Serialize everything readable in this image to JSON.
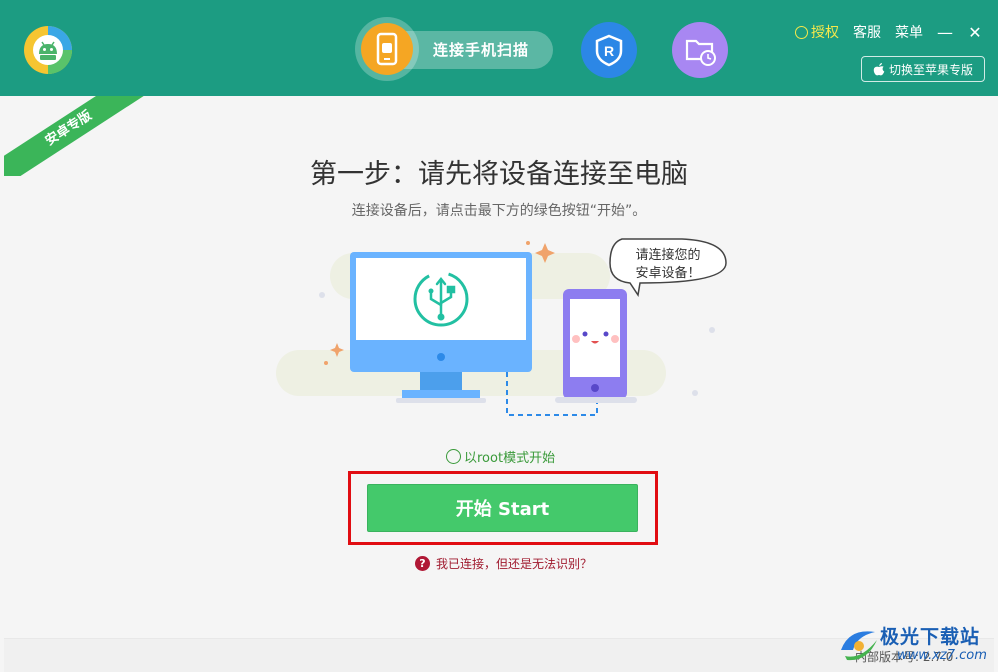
{
  "header": {
    "nav_label": "连接手机扫描",
    "auth_label": "授权",
    "service_label": "客服",
    "menu_label": "菜单",
    "switch_label": "切换至苹果专版",
    "minimize_label": "—",
    "close_label": "✕",
    "brand_color": "#1c9c82"
  },
  "ribbon": {
    "label": "安卓专版"
  },
  "main": {
    "title": "第一步：请先将设备连接至电脑",
    "subtitle": "连接设备后，请点击最下方的绿色按钮“开始”。",
    "bubble_line1": "请连接您的",
    "bubble_line2": "安卓设备！",
    "root_option_label": "以root模式开始",
    "start_button_label": "开始  Start",
    "help_label": "我已连接，但还是无法识别？",
    "help_icon_glyph": "?"
  },
  "footer": {
    "version_text": "内部版本号: 2.7.0",
    "watermark_text": "极光下载站",
    "watermark_url": "www.xz7.com"
  }
}
